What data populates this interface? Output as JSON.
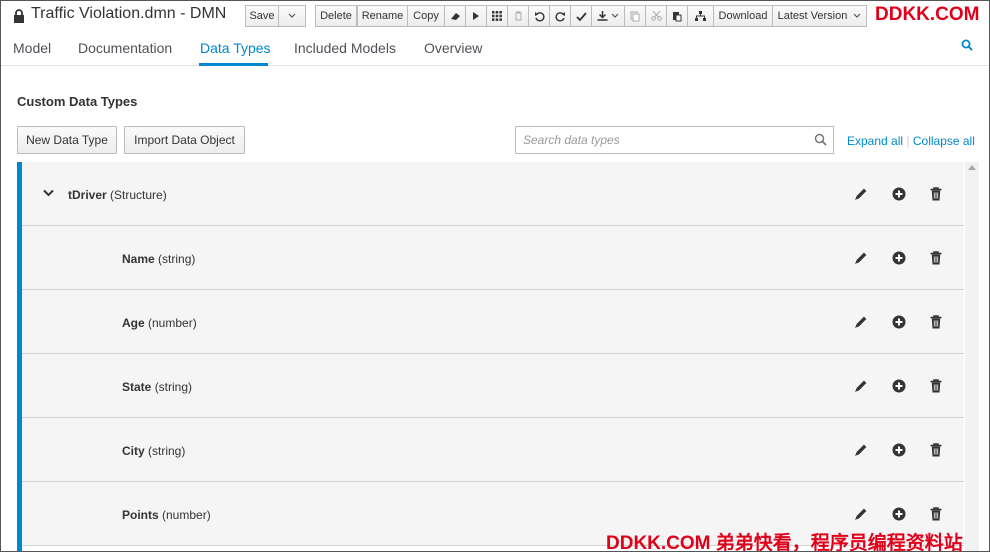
{
  "window": {
    "title": "Traffic Violation.dmn - DMN"
  },
  "toolbar": {
    "save": "Save",
    "delete": "Delete",
    "rename": "Rename",
    "copy": "Copy",
    "download": "Download",
    "latest_version": "Latest Version",
    "brand": "DDKK.COM"
  },
  "tabs": [
    {
      "label": "Model",
      "active": false
    },
    {
      "label": "Documentation",
      "active": false
    },
    {
      "label": "Data Types",
      "active": true
    },
    {
      "label": "Included Models",
      "active": false
    },
    {
      "label": "Overview",
      "active": false
    }
  ],
  "section": {
    "title": "Custom Data Types",
    "new_button": "New Data Type",
    "import_button": "Import Data Object",
    "search_placeholder": "Search data types",
    "expand_all": "Expand all",
    "separator": "|",
    "collapse_all": "Collapse all"
  },
  "data_types": [
    {
      "name": "tDriver",
      "type": "(Structure)",
      "level": 0,
      "expanded": true
    },
    {
      "name": "Name",
      "type": "(string)",
      "level": 1
    },
    {
      "name": "Age",
      "type": "(number)",
      "level": 1
    },
    {
      "name": "State",
      "type": "(string)",
      "level": 1
    },
    {
      "name": "City",
      "type": "(string)",
      "level": 1
    },
    {
      "name": "Points",
      "type": "(number)",
      "level": 1
    }
  ],
  "watermark": "DDKK.COM 弟弟快看，程序员编程资料站",
  "colors": {
    "accent": "#0088ce",
    "brand": "#e1001a",
    "row_bg": "#f5f5f5"
  },
  "icons": {
    "lock": "lock-icon",
    "search": "search-icon",
    "edit": "pencil-icon",
    "add": "plus-circle-icon",
    "delete": "trash-icon",
    "collapse": "chevron-down-icon"
  }
}
